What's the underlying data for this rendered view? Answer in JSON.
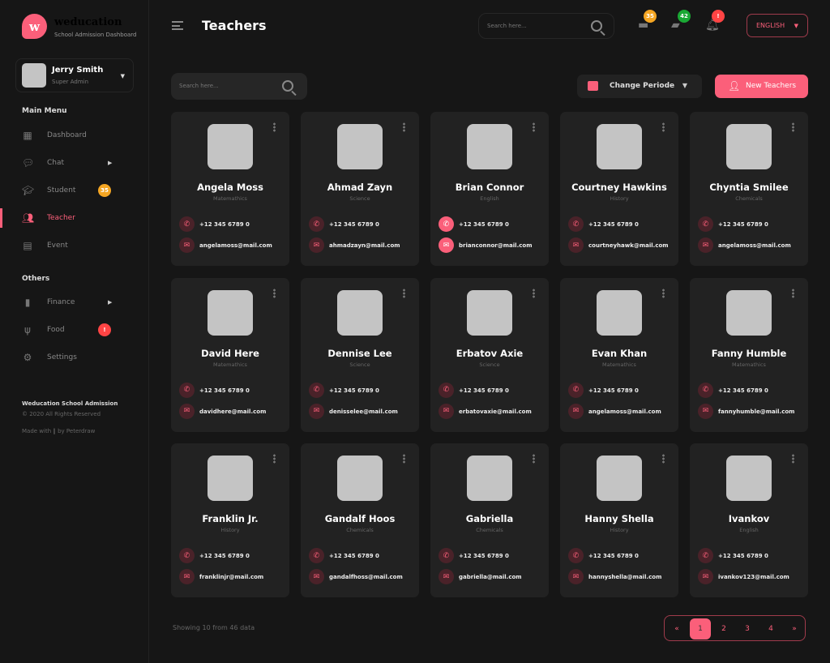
{
  "brand": {
    "name": "weducation",
    "subtitle": "School Admission Dashboard",
    "logo_letter": "w",
    "accent": "#fb5f7a"
  },
  "user": {
    "name": "Jerry Smith",
    "role": "Super Admin"
  },
  "sidebar": {
    "main_menu": "Main Menu",
    "others": "Others",
    "main": [
      {
        "label": "Dashboard",
        "icon": "grid-icon"
      },
      {
        "label": "Chat",
        "icon": "chat-icon",
        "arrow": true
      },
      {
        "label": "Student",
        "icon": "graduation-cap-icon",
        "badge": "35"
      },
      {
        "label": "Teacher",
        "icon": "users-icon",
        "active": true
      },
      {
        "label": "Event",
        "icon": "calendar-icon"
      }
    ],
    "other": [
      {
        "label": "Finance",
        "icon": "bar-chart-icon",
        "arrow": true
      },
      {
        "label": "Food",
        "icon": "utensils-icon",
        "badge": "!"
      },
      {
        "label": "Settings",
        "icon": "gear-icon"
      }
    ],
    "footer": {
      "title": "Weducation School Admission",
      "copyright": "© 2020 All Rights Reserved",
      "made": "Made with ‖ by Peterdraw"
    }
  },
  "header": {
    "title": "Teachers",
    "search_placeholder": "Search here...",
    "badges": {
      "files": "35",
      "messages": "42",
      "notifications": "!"
    },
    "language": "ENGLISH"
  },
  "toolbar": {
    "search_placeholder": "Search here...",
    "period": "Change Periode",
    "new": "New Teachers"
  },
  "teachers": [
    {
      "name": "Angela Moss",
      "subject": "Matemathics",
      "phone": "+12 345 6789 0",
      "email": "angelamoss@mail.com"
    },
    {
      "name": "Ahmad Zayn",
      "subject": "Science",
      "phone": "+12 345 6789 0",
      "email": "ahmadzayn@mail.com"
    },
    {
      "name": "Brian Connor",
      "subject": "English",
      "phone": "+12 345 6789 0",
      "email": "brianconnor@mail.com",
      "highlight": true
    },
    {
      "name": "Courtney Hawkins",
      "subject": "History",
      "phone": "+12 345 6789 0",
      "email": "courtneyhawk@mail.com"
    },
    {
      "name": "Chyntia Smilee",
      "subject": "Chemicals",
      "phone": "+12 345 6789 0",
      "email": "angelamoss@mail.com"
    },
    {
      "name": "David Here",
      "subject": "Matemathics",
      "phone": "+12 345 6789 0",
      "email": "davidhere@mail.com"
    },
    {
      "name": "Dennise Lee",
      "subject": "Science",
      "phone": "+12 345 6789 0",
      "email": "denisselee@mail.com"
    },
    {
      "name": "Erbatov Axie",
      "subject": "Science",
      "phone": "+12 345 6789 0",
      "email": "erbatovaxie@mail.com"
    },
    {
      "name": "Evan Khan",
      "subject": "Matemathics",
      "phone": "+12 345 6789 0",
      "email": "angelamoss@mail.com"
    },
    {
      "name": "Fanny Humble",
      "subject": "Matemathics",
      "phone": "+12 345 6789 0",
      "email": "fannyhumble@mail.com"
    },
    {
      "name": "Franklin Jr.",
      "subject": "History",
      "phone": "+12 345 6789 0",
      "email": "franklinjr@mail.com"
    },
    {
      "name": "Gandalf Hoos",
      "subject": "Chemicals",
      "phone": "+12 345 6789 0",
      "email": "gandalfhoss@mail.com"
    },
    {
      "name": "Gabriella",
      "subject": "Chemicals",
      "phone": "+12 345 6789 0",
      "email": "gabriella@mail.com"
    },
    {
      "name": "Hanny Shella",
      "subject": "History",
      "phone": "+12 345 6789 0",
      "email": "hannyshella@mail.com"
    },
    {
      "name": "Ivankov",
      "subject": "English",
      "phone": "+12 345 6789 0",
      "email": "ivankov123@mail.com"
    }
  ],
  "footer": {
    "showing": "Showing 10 from 46 data",
    "pages": [
      "«",
      "1",
      "2",
      "3",
      "4",
      "»"
    ],
    "current": "1"
  }
}
